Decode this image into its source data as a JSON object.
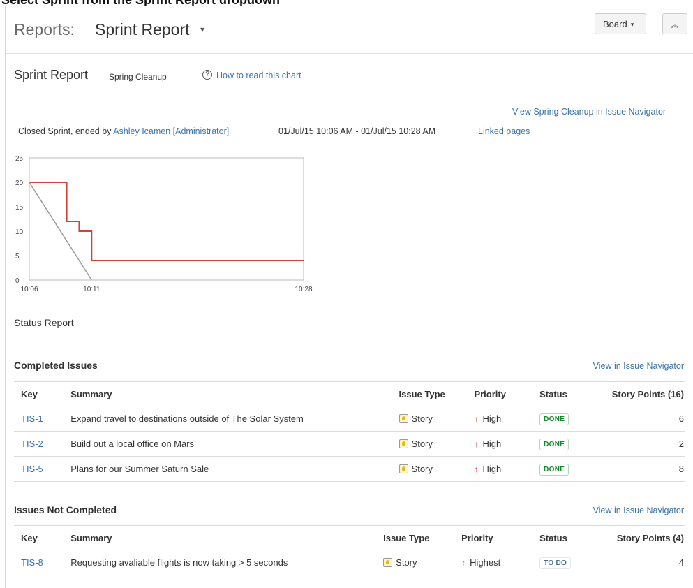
{
  "page": {
    "top_instruction": "Select Sprint from the Sprint Report dropdown",
    "breadcrumb_prefix": "Reports:",
    "report_title": "Sprint Report",
    "board_button": "Board",
    "collapse_icon": "double-chevron-up-icon"
  },
  "report": {
    "heading": "Sprint Report",
    "sprint_name": "Spring Cleanup",
    "help_link": "How to read this chart",
    "view_issue_navigator": "View Spring Cleanup in Issue Navigator",
    "closed_prefix": "Closed Sprint, ended by ",
    "ended_by": "Ashley Icamen [Administrator]",
    "dates": "01/Jul/15 10:06 AM - 01/Jul/15 10:28 AM",
    "linked_pages": "Linked pages"
  },
  "chart_data": {
    "type": "line",
    "x_ticks": [
      "10:06",
      "10:11",
      "10:28"
    ],
    "y_ticks": [
      0,
      5,
      10,
      15,
      20,
      25
    ],
    "ylim": [
      0,
      25
    ],
    "xlim": [
      "10:06",
      "10:28"
    ],
    "grid": false,
    "series": [
      {
        "color": "#d04437",
        "style": "step",
        "points": [
          [
            "10:06",
            20
          ],
          [
            "10:09",
            20
          ],
          [
            "10:09",
            12
          ],
          [
            "10:10",
            12
          ],
          [
            "10:10",
            10
          ],
          [
            "10:11",
            10
          ],
          [
            "10:11",
            4
          ],
          [
            "10:28",
            4
          ]
        ]
      },
      {
        "color": "#999999",
        "style": "line",
        "points": [
          [
            "10:06",
            20
          ],
          [
            "10:11",
            0
          ]
        ]
      }
    ]
  },
  "status_report": "Status Report",
  "completed": {
    "title": "Completed Issues",
    "nav_link": "View in Issue Navigator",
    "columns": [
      "Key",
      "Summary",
      "Issue Type",
      "Priority",
      "Status",
      "Story Points (16)"
    ],
    "rows": [
      {
        "key": "TIS-1",
        "summary": "Expand travel to destinations outside of The Solar System",
        "type": "Story",
        "priority": "High",
        "status": "DONE",
        "points": "6"
      },
      {
        "key": "TIS-2",
        "summary": "Build out a local office on Mars",
        "type": "Story",
        "priority": "High",
        "status": "DONE",
        "points": "2"
      },
      {
        "key": "TIS-5",
        "summary": "Plans for our Summer Saturn Sale",
        "type": "Story",
        "priority": "High",
        "status": "DONE",
        "points": "8"
      }
    ]
  },
  "not_completed": {
    "title": "Issues Not Completed",
    "nav_link": "View in Issue Navigator",
    "columns": [
      "Key",
      "Summary",
      "Issue Type",
      "Priority",
      "Status",
      "Story Points (4)"
    ],
    "rows": [
      {
        "key": "TIS-8",
        "summary": "Requesting avaliable flights is now taking > 5 seconds",
        "type": "Story",
        "priority": "Highest",
        "status": "TO DO",
        "points": "4"
      }
    ]
  },
  "colors": {
    "link": "#3b73af",
    "done": "#14892c",
    "todo": "#4a6785",
    "burndown": "#d04437",
    "guideline": "#999999"
  }
}
